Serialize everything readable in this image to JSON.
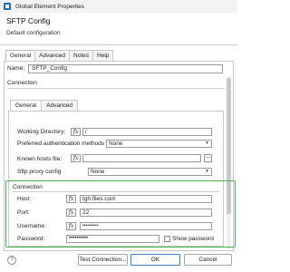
{
  "window": {
    "title": "Global Element Properties"
  },
  "header": {
    "title": "SFTP Config",
    "subtitle": "Default configuration"
  },
  "outer_tabs": [
    {
      "label": "General",
      "active": true
    },
    {
      "label": "Advanced"
    },
    {
      "label": "Notes"
    },
    {
      "label": "Help"
    }
  ],
  "name_field": {
    "label": "Name:",
    "value": "SFTP_Config"
  },
  "connection_section": {
    "label": "Connection"
  },
  "inner_tabs": [
    {
      "label": "General",
      "active": true
    },
    {
      "label": "Advanced"
    }
  ],
  "general": {
    "working_directory": {
      "label": "Working Directory:",
      "value": "/"
    },
    "preferred_auth": {
      "label": "Preferred authentication methods",
      "value": "None"
    },
    "known_hosts": {
      "label": "Known hosts file:",
      "value": "",
      "browse": "..."
    },
    "proxy": {
      "label": "Sftp proxy config",
      "value": "None"
    }
  },
  "connection": {
    "title": "Connection",
    "host": {
      "label": "Host:",
      "value": "tgh.files.com"
    },
    "port": {
      "label": "Port:",
      "value": "22"
    },
    "username": {
      "label": "Username:",
      "value": "••••••••••"
    },
    "password": {
      "label": "Password:",
      "value": "••••••••••"
    },
    "show_password": {
      "label": "Show password"
    }
  },
  "footer": {
    "help": "?",
    "test_connection": "Test Connection...",
    "ok": "OK",
    "cancel": "Cancel"
  },
  "icons": {
    "fx": "fx"
  },
  "colors": {
    "highlight": "#4caf50",
    "primary_button_border": "#3c7fc6"
  }
}
